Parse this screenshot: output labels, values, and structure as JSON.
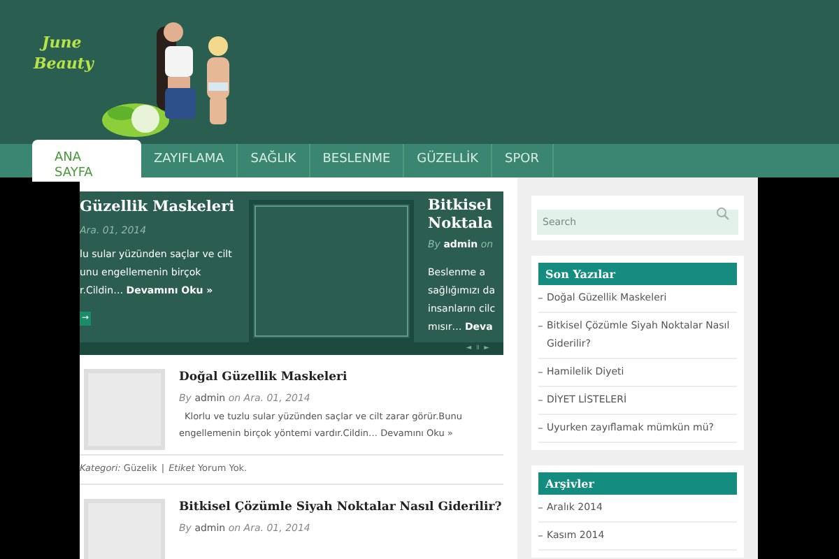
{
  "logo": {
    "text_lines": [
      "June",
      "Beauty"
    ]
  },
  "nav": [
    {
      "label": "ANA SAYFA",
      "selected": true
    },
    {
      "label": "ZAYIFLAMA",
      "selected": false
    },
    {
      "label": "SAĞLIK",
      "selected": false
    },
    {
      "label": "BESLENME",
      "selected": false
    },
    {
      "label": "GÜZELLİK",
      "selected": false
    },
    {
      "label": "SPOR",
      "selected": false
    }
  ],
  "slider": {
    "slides": [
      {
        "title": "Güzellik Maskeleri",
        "meta": "Ara. 01, 2014",
        "lines": [
          "lu sular yüzünden saçlar ve cilt",
          "unu engellemenin birçok"
        ],
        "last": "r.Cildin…",
        "more": "Devamını Oku »",
        "button": "→"
      },
      {
        "title": "Bitkisel Noktala",
        "author": "admin",
        "by": "By",
        "on": "on",
        "lines": [
          "Beslenme a",
          "sağlığımızı da",
          "insanların cilc"
        ],
        "last": "mısır…",
        "more": "Deva"
      }
    ],
    "controls": [
      "◄",
      "॥",
      "►"
    ]
  },
  "posts": [
    {
      "title": "Doğal Güzellik Maskeleri",
      "by": "By",
      "author": "admin",
      "on": "on Ara. 01, 2014",
      "excerpt": "Klorlu ve tuzlu sular yüzünden saçlar ve cilt zarar görür.Bunu engellemenin birçok yöntemi vardır.Cildin…",
      "more": "Devamını Oku »",
      "category_label": "Kategori:",
      "category": "Güzelik",
      "separator": "|",
      "tag_label": "Etiket",
      "comments": "Yorum Yok."
    },
    {
      "title": "Bitkisel Çözümle Siyah Noktalar Nasıl Giderilir?",
      "by": "By",
      "author": "admin",
      "on": "on Ara. 01, 2014"
    }
  ],
  "search": {
    "placeholder": "Search"
  },
  "widgets": [
    {
      "title": "Son Yazılar",
      "items": [
        "Doğal Güzellik Maskeleri",
        "Bitkisel Çözümle Siyah Noktalar Nasıl Giderilir?",
        "Hamilelik Diyeti",
        "DİYET LİSTELERİ",
        "Uyurken zayıflamak mümkün mü?"
      ]
    },
    {
      "title": "Arşivler",
      "items": [
        "Aralık 2014",
        "Kasım 2014"
      ]
    }
  ]
}
